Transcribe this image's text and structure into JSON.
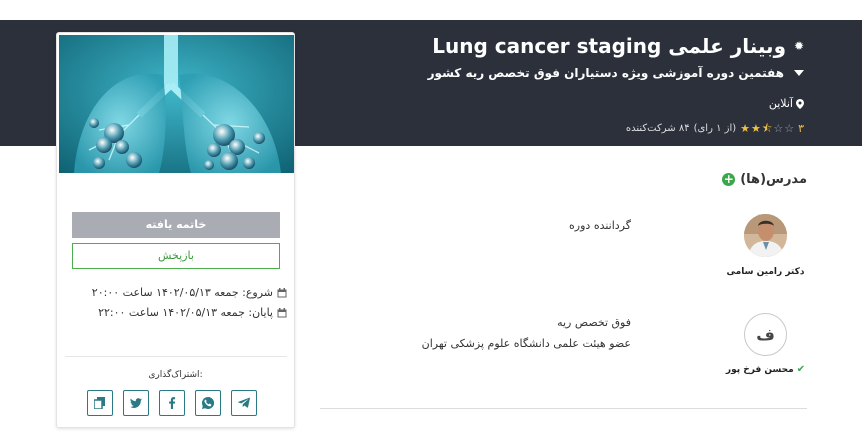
{
  "header": {
    "title": "وبینار علمی Lung cancer staging",
    "subtitle": "هفتمین دوره آموزشی ویژه دستیاران فوق تخصص ریه کشور",
    "location": "آنلاین",
    "rating_value": "۳",
    "rating_stars": 2.5,
    "rating_count": "(از ۱ رای)",
    "participants": "۸۴ شرکت‌کننده"
  },
  "card": {
    "image_icon": "lungs-illustration",
    "ended_label": "خاتمه یافته",
    "replay_label": "بازپخش",
    "start_date": "شروع: جمعه ۱۴۰۲/۰۵/۱۳ ساعت ۲۰:۰۰",
    "end_date": "پایان: جمعه ۱۴۰۲/۰۵/۱۳ ساعت ۲۲:۰۰",
    "share_label": "اشتراک‌گذاری:",
    "share_icons": [
      "telegram-icon",
      "whatsapp-icon",
      "facebook-icon",
      "twitter-icon",
      "copy-icon"
    ]
  },
  "instructors": {
    "section_title": "مدرس(ها)",
    "items": [
      {
        "name": "دکتر رامین سامی",
        "role": "گرداننده دوره",
        "avatar": "photo"
      },
      {
        "name": "محسن فرخ پور",
        "avatar_letter": "ف",
        "role": "فوق تخصص ریه",
        "affiliation": "عضو هیئت علمی دانشگاه علوم پزشکی تهران",
        "verified": true
      }
    ]
  },
  "colors": {
    "header_bg": "#2b303b",
    "accent_green": "#3aa84a",
    "share_teal": "#2a7a86",
    "star_yellow": "#f0c040"
  }
}
